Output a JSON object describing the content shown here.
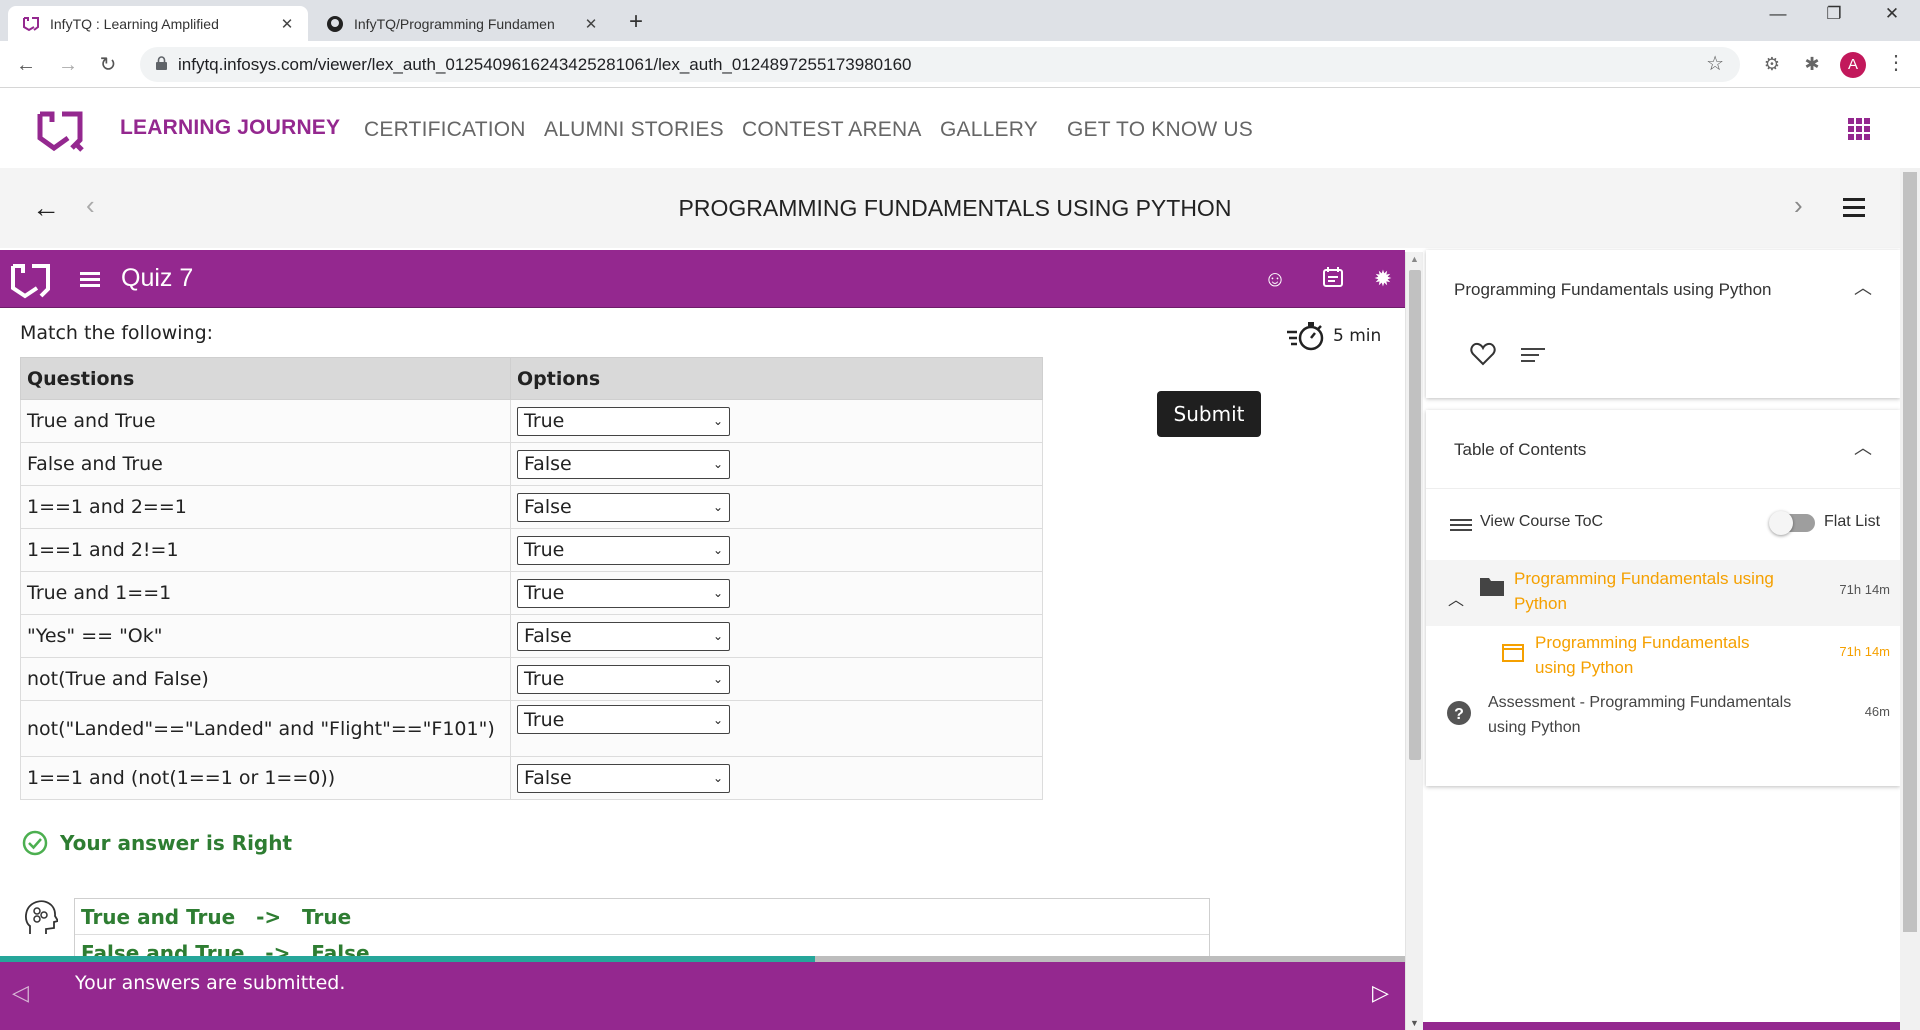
{
  "browser": {
    "tabs": [
      {
        "title": "InfyTQ : Learning Amplified",
        "close": "✕"
      },
      {
        "title": "InfyTQ/Programming Fundamen",
        "close": "✕"
      }
    ],
    "new_tab": "+",
    "window_controls": {
      "minimize": "—",
      "restore": "❐",
      "close": "✕"
    },
    "url": "infytq.infosys.com/viewer/lex_auth_01254096162434252810​61/lex_auth_0124897255173980160",
    "avatar_letter": "A"
  },
  "site": {
    "nav": [
      "LEARNING JOURNEY",
      "CERTIFICATION",
      "ALUMNI STORIES",
      "CONTEST ARENA",
      "GALLERY",
      "GET TO KNOW US"
    ],
    "brand_color": "#94288f"
  },
  "course": {
    "title": "PROGRAMMING FUNDAMENTALS USING PYTHON"
  },
  "quiz": {
    "title": "Quiz 7",
    "prompt": "Match the following:",
    "timer": "5 min",
    "headers": {
      "questions": "Questions",
      "options": "Options"
    },
    "rows": [
      {
        "q": "True and True",
        "a": "True"
      },
      {
        "q": "False and True",
        "a": "False"
      },
      {
        "q": "1==1 and 2==1",
        "a": "False"
      },
      {
        "q": "1==1 and 2!=1",
        "a": "True"
      },
      {
        "q": "True and 1==1",
        "a": "True"
      },
      {
        "q": "\"Yes\" == \"Ok\"",
        "a": "False"
      },
      {
        "q": "not(True and False)",
        "a": "True"
      },
      {
        "q": "not(\"Landed\"==\"Landed\" and \"Flight\"==\"F101\")",
        "a": "True"
      },
      {
        "q": "1==1 and (not(1==1 or 1==0))",
        "a": "False"
      }
    ],
    "submit_label": "Submit",
    "result": "Your answer is Right",
    "explanations": [
      "True and True   ->   True",
      "False and True   ->   False"
    ],
    "progress": 0.58,
    "footer_message": "Your answers are submitted."
  },
  "sidebar": {
    "course_card_title": "Programming Fundamentals using Python",
    "toc_title": "Table of Contents",
    "view_toc_label": "View Course ToC",
    "flat_list_label": "Flat List",
    "items": [
      {
        "name": "Programming Fundamentals using Python",
        "duration": "71h 14m"
      },
      {
        "name": "Programming Fundamentals using Python",
        "duration": "71h 14m"
      },
      {
        "name": "Assessment - Programming Fundamentals using Python",
        "duration": "46m"
      }
    ]
  }
}
